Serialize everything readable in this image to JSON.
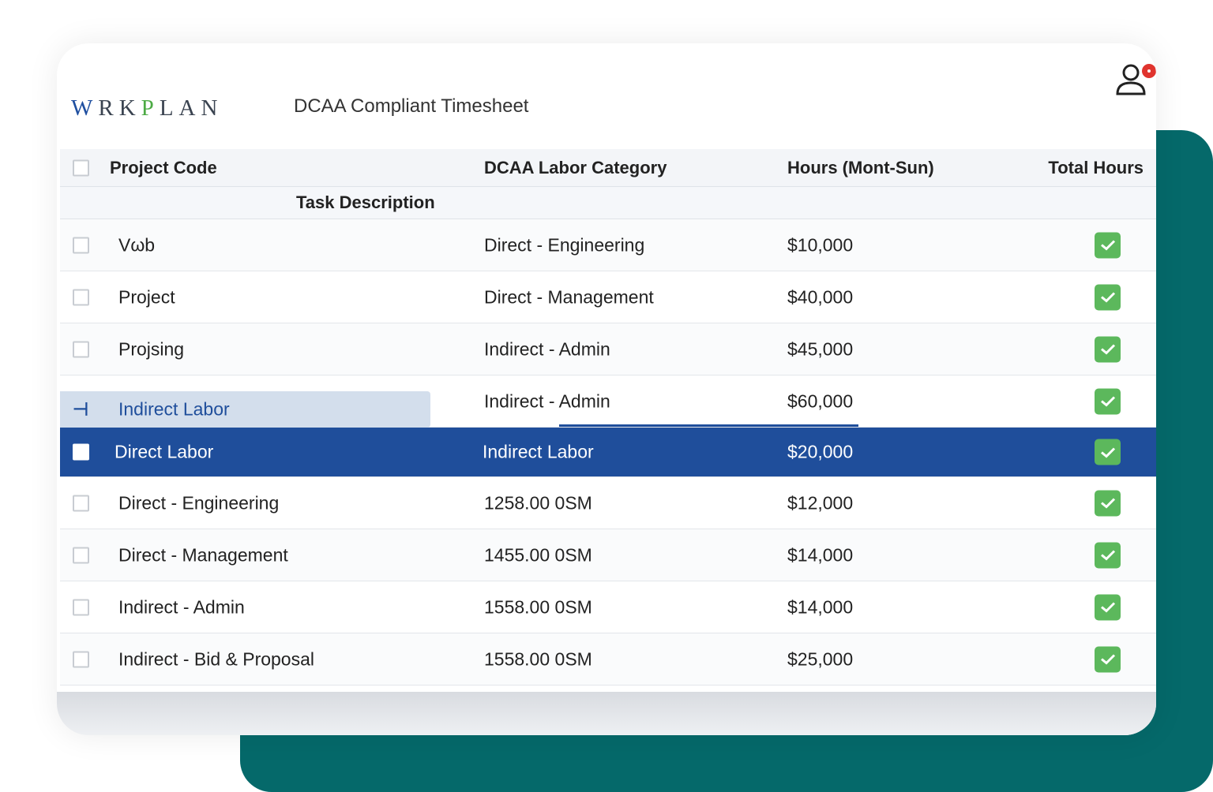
{
  "brand": {
    "logo": "WRKPLAN",
    "title": "DCAA Compliant Timesheet"
  },
  "colors": {
    "teal": "#05696a",
    "selected": "#1f4e9b",
    "check": "#5cb85c",
    "notification": "#e0342e"
  },
  "header": {
    "project_code": "Project Code",
    "labor_category": "DCAA Labor Category",
    "hours": "Hours (Mont-Sun)",
    "total_hours": "Total Hours",
    "task_description": "Task Description"
  },
  "rows": [
    {
      "c1": "Vωb",
      "c2": "Direct - Engineering",
      "c3": "$10,000",
      "checked": true
    },
    {
      "c1": "Project",
      "c2": "Direct - Management",
      "c3": "$40,000",
      "checked": true
    },
    {
      "c1": "Projsing",
      "c2": "Indirect - Admin",
      "c3": "$45,000",
      "checked": true
    },
    {
      "c1": "Indirect Labor",
      "c2": "Indirect - Admin",
      "c3": "$60,000",
      "checked": true,
      "dragging": true
    },
    {
      "c1": "Direct Labor",
      "c2": "Indirect Labor",
      "c3": "$20,000",
      "checked": true,
      "selected": true
    },
    {
      "c1": "Direct - Engineering",
      "c2": "1258.00 0SM",
      "c3": "$12,000",
      "checked": true
    },
    {
      "c1": "Direct - Management",
      "c2": "1455.00 0SM",
      "c3": "$14,000",
      "checked": true
    },
    {
      "c1": "Indirect - Admin",
      "c2": "1558.00 0SM",
      "c3": "$14,000",
      "checked": true
    },
    {
      "c1": "Indirect - Bid & Proposal",
      "c2": "1558.00 0SM",
      "c3": "$25,000",
      "checked": true
    }
  ]
}
